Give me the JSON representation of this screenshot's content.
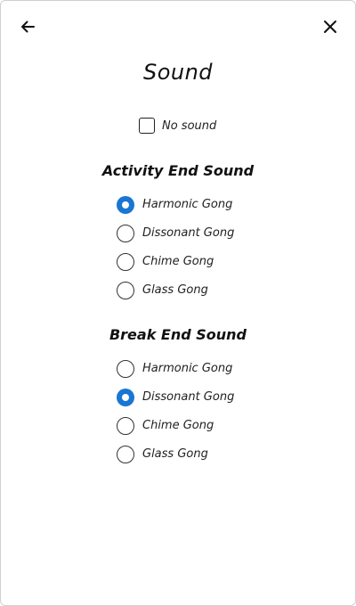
{
  "header": {
    "back_icon": "arrow-left-icon",
    "close_icon": "close-icon",
    "title": "Sound"
  },
  "mute": {
    "label": "No sound",
    "checked": false
  },
  "activity_end": {
    "heading": "Activity End Sound",
    "selected": "Harmonic Gong",
    "options": [
      {
        "label": "Harmonic Gong",
        "checked": true
      },
      {
        "label": "Dissonant Gong",
        "checked": false
      },
      {
        "label": "Chime Gong",
        "checked": false
      },
      {
        "label": "Glass Gong",
        "checked": false
      }
    ]
  },
  "break_end": {
    "heading": "Break End Sound",
    "selected": "Dissonant Gong",
    "options": [
      {
        "label": "Harmonic Gong",
        "checked": false
      },
      {
        "label": "Dissonant Gong",
        "checked": true
      },
      {
        "label": "Chime Gong",
        "checked": false
      },
      {
        "label": "Glass Gong",
        "checked": false
      }
    ]
  },
  "colors": {
    "accent": "#1976d2",
    "text": "#111111",
    "border": "#cfcfcf"
  }
}
